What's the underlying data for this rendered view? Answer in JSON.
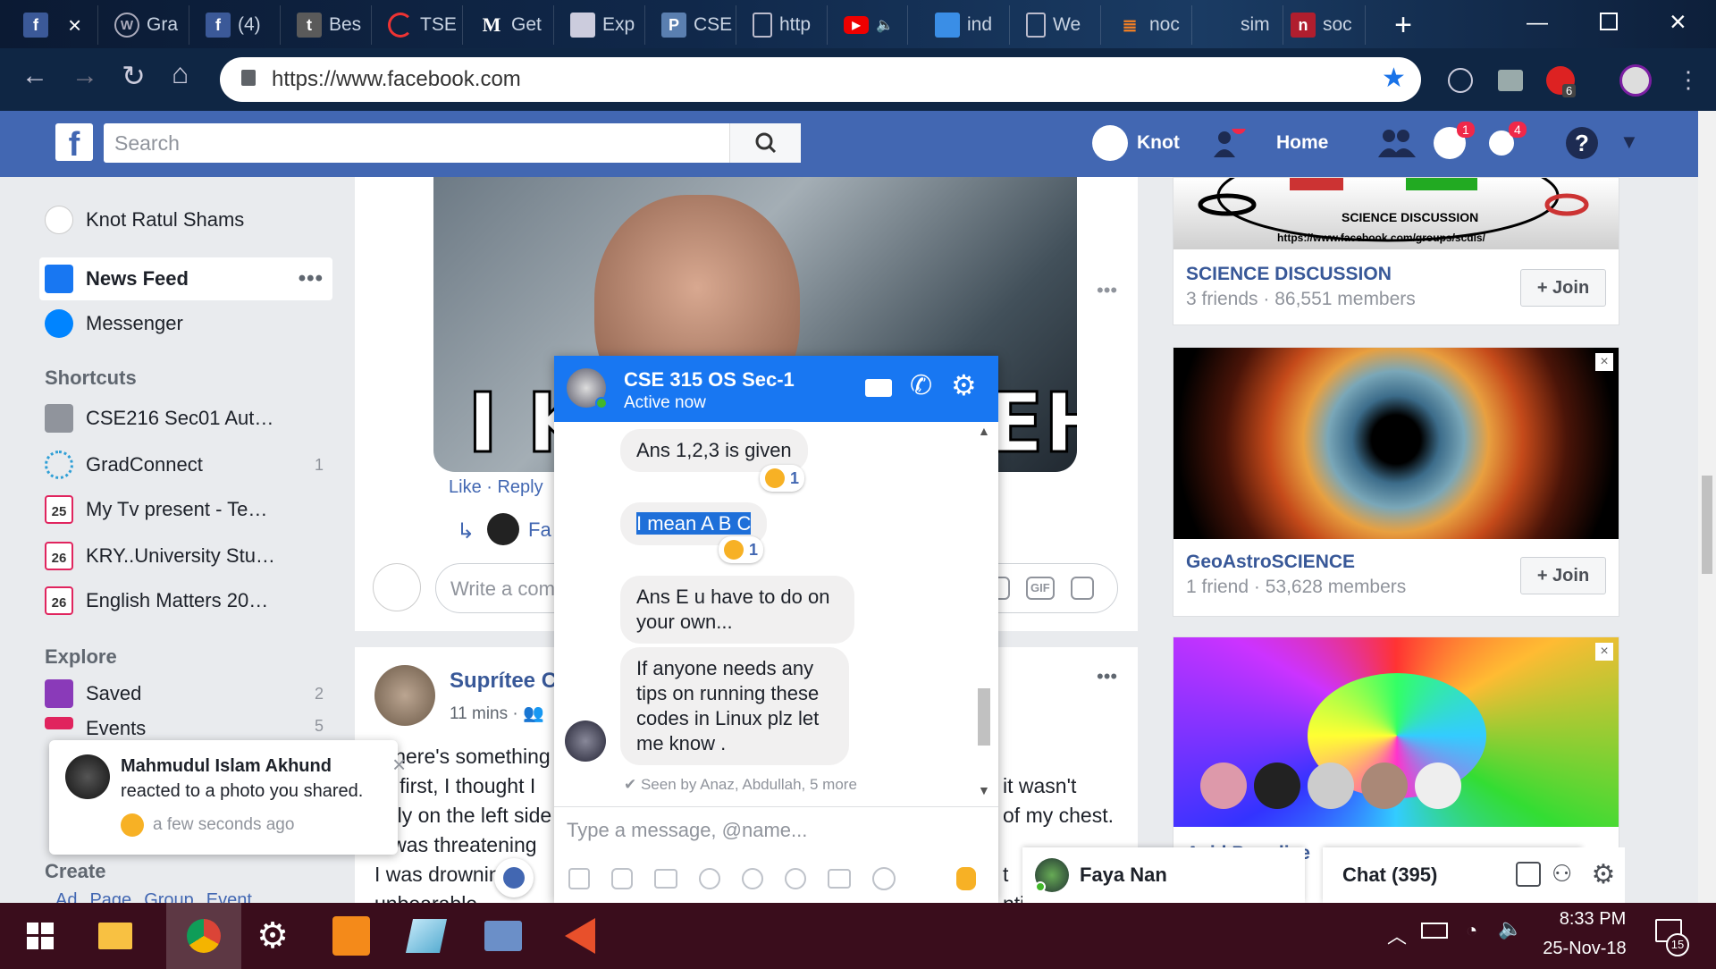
{
  "browser": {
    "tabs": [
      {
        "label": "",
        "icon": "facebook-icon"
      },
      {
        "label": "Gra",
        "icon": "wordpress-icon"
      },
      {
        "label": "(4)",
        "icon": "facebook-icon"
      },
      {
        "label": "Bes",
        "icon": "tumblr-icon"
      },
      {
        "label": "TSE",
        "icon": "loading-icon"
      },
      {
        "label": "Get",
        "icon": "medium-icon"
      },
      {
        "label": "Exp",
        "icon": "puzzle-icon"
      },
      {
        "label": "CSE",
        "icon": "p-icon"
      },
      {
        "label": "http",
        "icon": "page-icon"
      },
      {
        "label": "",
        "icon": "youtube-icon"
      },
      {
        "label": "ind",
        "icon": "photo-icon"
      },
      {
        "label": "We",
        "icon": "page-icon"
      },
      {
        "label": "noc",
        "icon": "stackoverflow-icon"
      },
      {
        "label": "sim",
        "icon": "blank-icon"
      },
      {
        "label": "soc",
        "icon": "n-icon"
      }
    ],
    "url": "https://www.facebook.com",
    "extension_badge": "6"
  },
  "facebook": {
    "search_placeholder": "Search",
    "profile_name": "Knot",
    "home_label": "Home",
    "messenger_badge": "1",
    "notifications_badge": "4"
  },
  "left_nav": {
    "user_name": "Knot Ratul Shams",
    "news_feed": "News Feed",
    "messenger": "Messenger",
    "shortcuts_title": "Shortcuts",
    "shortcuts": [
      {
        "label": "CSE216 Sec01 Aut…",
        "count": ""
      },
      {
        "label": "GradConnect",
        "count": "1"
      },
      {
        "label": "My Tv present - Te…",
        "count": ""
      },
      {
        "label": "KRY..University Stu…",
        "count": ""
      },
      {
        "label": "English Matters 20…",
        "count": ""
      }
    ],
    "calendar_days": [
      "25",
      "26",
      "26"
    ],
    "explore_title": "Explore",
    "saved_label": "Saved",
    "saved_count": "2",
    "events_label": "Events",
    "events_count": "5",
    "create_title": "Create",
    "create_links": [
      "Ad",
      "Page",
      "Group",
      "Event"
    ]
  },
  "post1": {
    "image_caption_left": "I KI",
    "image_caption_right": "EH",
    "like": "Like",
    "reply": "Reply",
    "reply_author_partial": "Fa",
    "comment_placeholder": "Write a com",
    "gif_label": "GIF"
  },
  "post2": {
    "author_partial": "Suprítee C",
    "time": "11 mins",
    "lines": [
      "\"There's something",
      "At first, I thought I",
      "only on the left side",
      "It was threatening",
      "I was drowning in",
      "unbearable"
    ],
    "right_lines": [
      "it wasn't",
      "of my chest.",
      "t",
      "ntil"
    ]
  },
  "right_col": {
    "group1_banner_text": "SCIENCE DISCUSSION",
    "group1_banner_url": "https://www.facebook.com/groups/scdis/",
    "group1_name": "SCIENCE DISCUSSION",
    "group1_meta": "3 friends · 86,551 members",
    "join_label": "+ Join",
    "group2_name": "GeoAstroSCIENCE",
    "group2_meta": "1 friend · 53,628 members",
    "group3_partial": "Acid Paradise"
  },
  "chat": {
    "title": "CSE 315 OS Sec-1",
    "status": "Active now",
    "messages": [
      {
        "text": "Ans 1,2,3 is given",
        "reaction_count": "1"
      },
      {
        "text": "I mean A B C",
        "reaction_count": "1"
      },
      {
        "text": "Ans E u have to do on your own..."
      },
      {
        "text": "If anyone needs any tips on running these codes in Linux plz let me know ."
      }
    ],
    "seen": "Seen by Anaz, Abdullah, 5 more",
    "input_placeholder": "Type a message, @name..."
  },
  "notification": {
    "name": "Mahmudul Islam Akhund",
    "action": "reacted to a photo you shared.",
    "time": "a few seconds ago"
  },
  "chat_tabs": {
    "faya": "Faya Nan",
    "chat_label": "Chat (395)"
  },
  "taskbar": {
    "time": "8:33 PM",
    "date": "25-Nov-18",
    "notification_count": "15"
  },
  "colors": {
    "facebook_blue": "#4267b2",
    "messenger_blue": "#1877f2",
    "taskbar": "#3a0d1c"
  }
}
